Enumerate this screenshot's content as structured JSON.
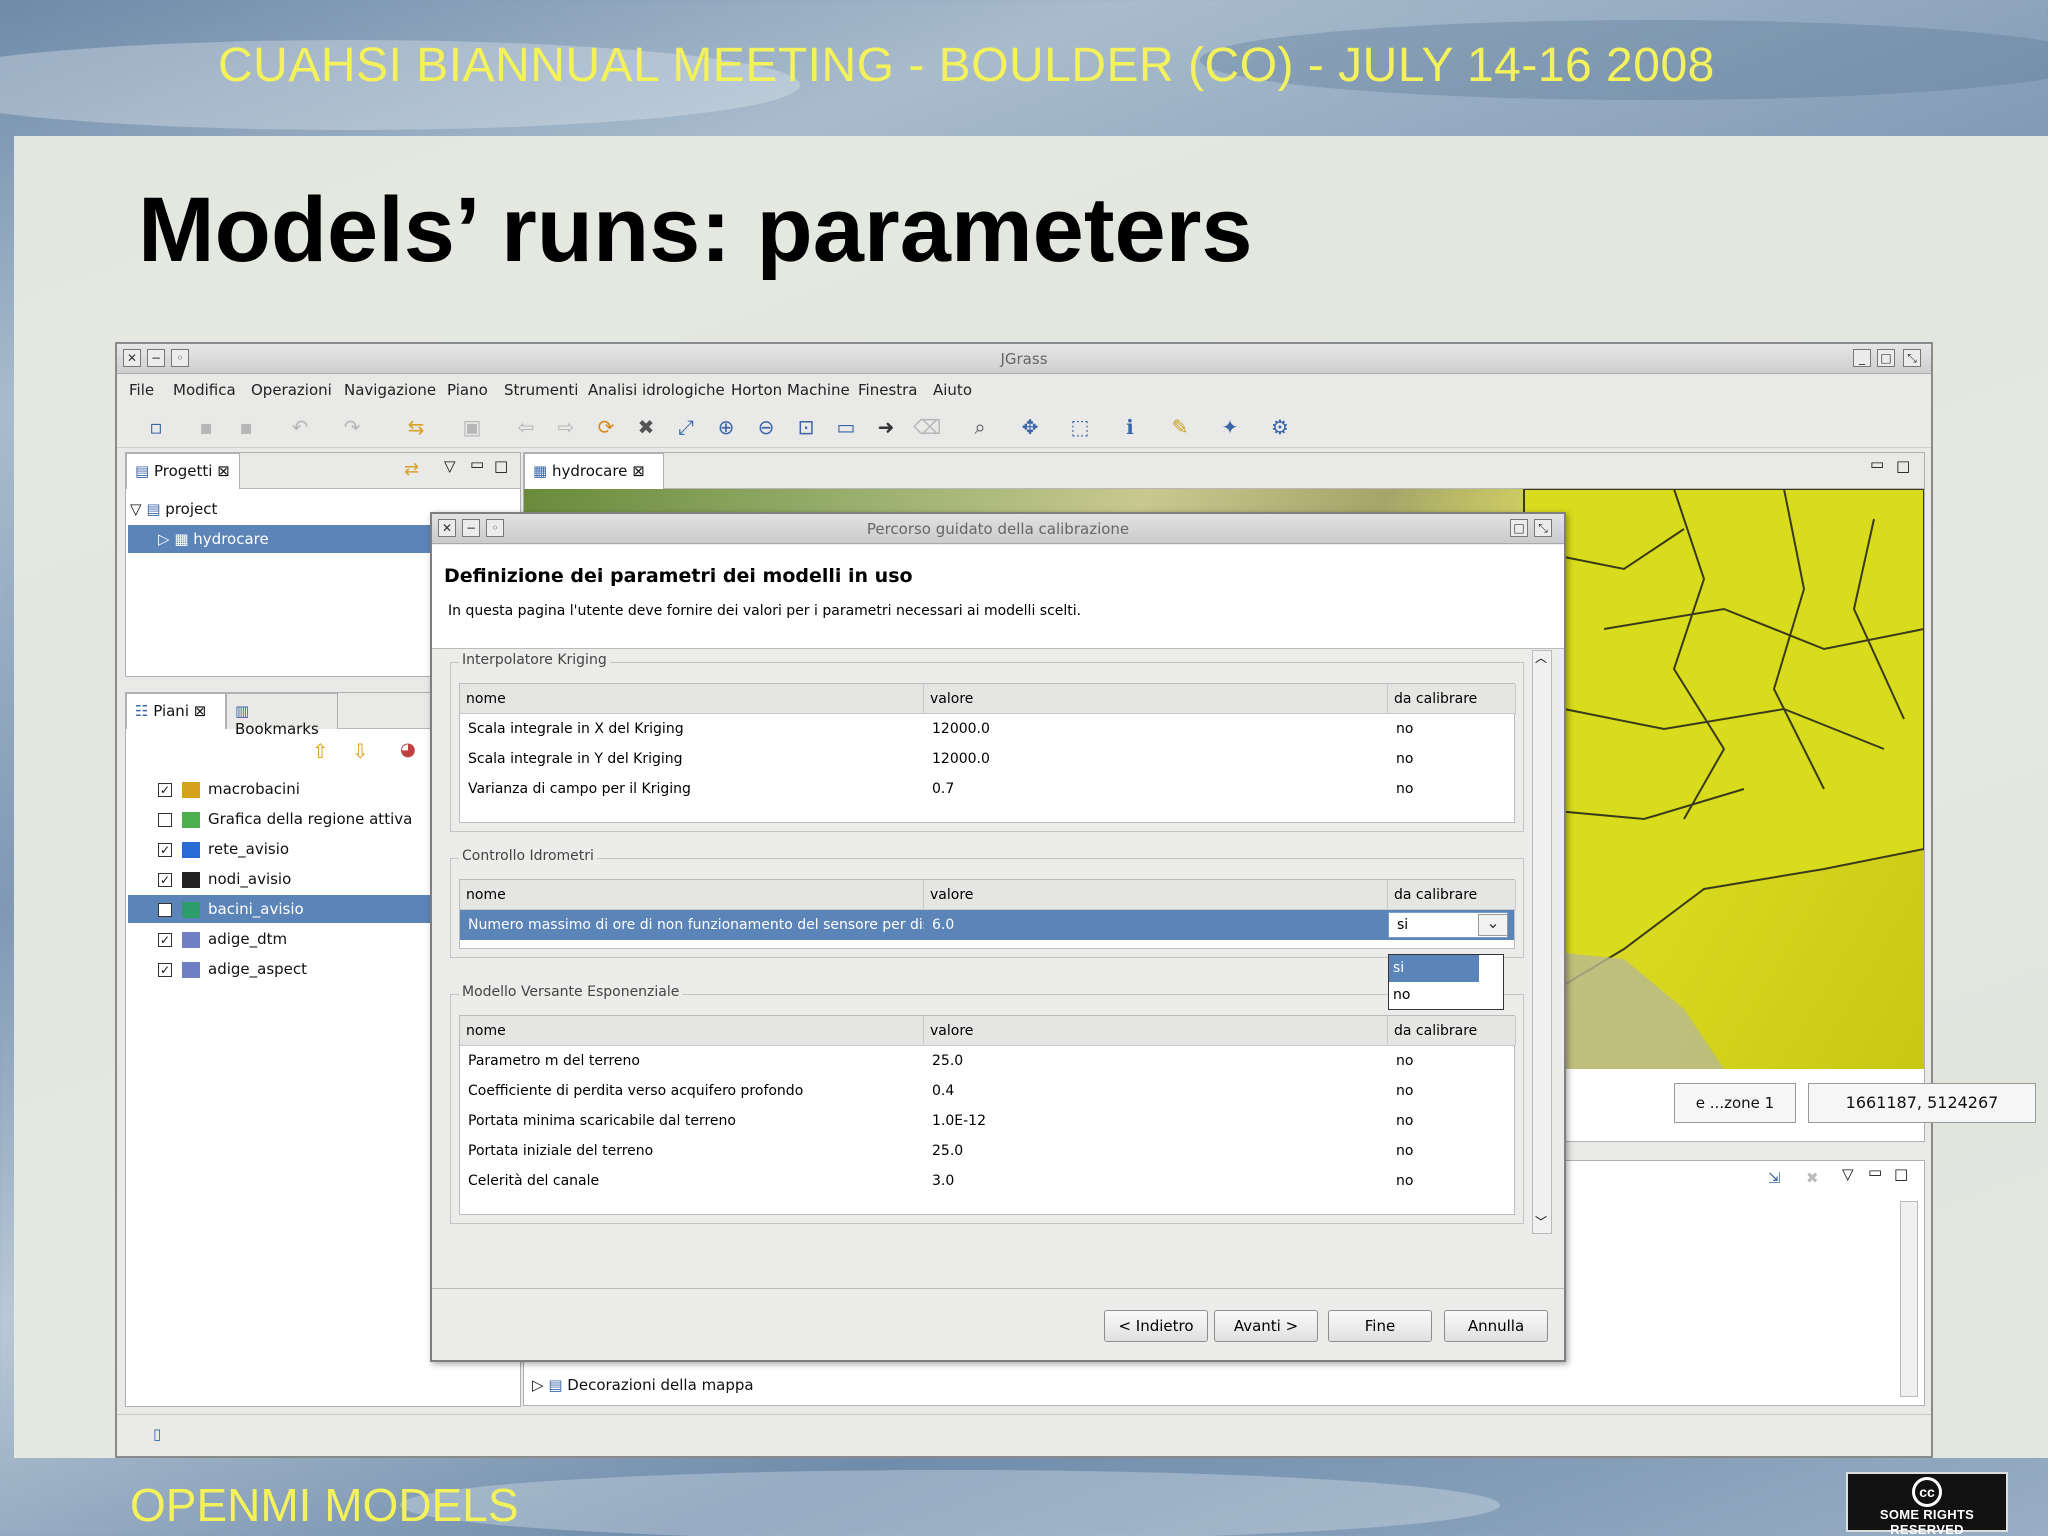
{
  "slide": {
    "header": "CUAHSI BIANNUAL MEETING - BOULDER (CO) - JULY 14-16 2008",
    "title": "Models’ runs: parameters",
    "footer": "OPENMI MODELS",
    "license": "SOME RIGHTS RESERVED",
    "license_symbol": "cc"
  },
  "app": {
    "window_title": "JGrass",
    "menu": [
      "File",
      "Modifica",
      "Operazioni",
      "Navigazione",
      "Piano",
      "Strumenti",
      "Analisi idrologiche",
      "Horton Machine",
      "Finestra",
      "Aiuto"
    ],
    "projects_panel": {
      "tab": "Progetti",
      "items": [
        "project",
        "hydrocare"
      ]
    },
    "layers_panel": {
      "tabs": [
        "Piani",
        "Bookmarks"
      ],
      "layers": [
        {
          "name": "macrobacini",
          "checked": true,
          "color": "#d6a21c"
        },
        {
          "name": "Grafica della regione attiva",
          "checked": false,
          "color": "#4bb04b"
        },
        {
          "name": "rete_avisio",
          "checked": true,
          "color": "#2a6cd6"
        },
        {
          "name": "nodi_avisio",
          "checked": true,
          "color": "#222222"
        },
        {
          "name": "bacini_avisio",
          "checked": true,
          "color": "#2c9c6a"
        },
        {
          "name": "adige_dtm",
          "checked": true,
          "color": "#6f7fc4"
        },
        {
          "name": "adige_aspect",
          "checked": true,
          "color": "#6f7fc4"
        }
      ]
    },
    "map": {
      "tab": "hydrocare",
      "crs_label": "e ...zone 1",
      "coords": "1661187, 5124267"
    },
    "bottom_panel": {
      "tree_item": "Decorazioni della mappa"
    }
  },
  "dialog": {
    "window_title": "Percorso guidato della calibrazione",
    "heading": "Definizione dei parametri dei modelli in uso",
    "description": "In questa pagina l'utente deve fornire dei valori per i parametri necessari ai modelli scelti.",
    "columns": [
      "nome",
      "valore",
      "da calibrare"
    ],
    "groups": [
      {
        "title": "Interpolatore Kriging",
        "rows": [
          [
            "Scala integrale in X del Kriging",
            "12000.0",
            "no"
          ],
          [
            "Scala integrale in Y del Kriging",
            "12000.0",
            "no"
          ],
          [
            "Varianza di campo per il Kriging",
            "0.7",
            "no"
          ]
        ]
      },
      {
        "title": "Controllo Idrometri",
        "rows": [
          [
            "Numero massimo di ore di non funzionamento del sensore per disa",
            "6.0",
            "si"
          ]
        ]
      },
      {
        "title": "Modello Versante Esponenziale",
        "rows": [
          [
            "Parametro m del terreno",
            "25.0",
            "no"
          ],
          [
            "Coefficiente di perdita verso acquifero profondo",
            "0.4",
            "no"
          ],
          [
            "Portata minima scaricabile dal terreno",
            "1.0E-12",
            "no"
          ],
          [
            "Portata iniziale del terreno",
            "25.0",
            "no"
          ],
          [
            "Celerità del canale",
            "3.0",
            "no"
          ]
        ]
      }
    ],
    "dropdown_options": [
      "si",
      "no"
    ],
    "buttons": {
      "back": "< Indietro",
      "next": "Avanti >",
      "finish": "Fine",
      "cancel": "Annulla"
    }
  }
}
